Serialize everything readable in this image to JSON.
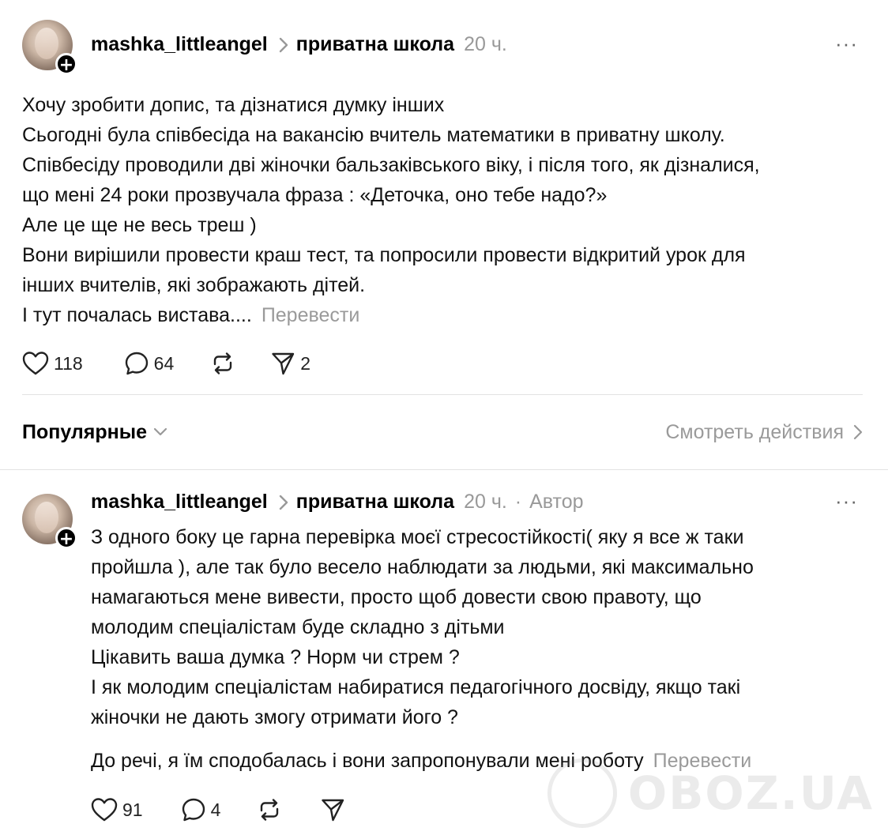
{
  "post": {
    "username": "mashka_littleangel",
    "community": "приватна школа",
    "time": "20 ч.",
    "more_icon": "···",
    "lines": [
      "Хочу зробити допис, та дізнатися думку інших",
      "Сьогодні була співбесіда на вакансію вчитель математики в приватну школу.",
      "Співбесіду проводили дві жіночки бальзаківського віку, і після того, як дізналися,",
      "що мені 24 роки прозвучала фраза : «Деточка, оно тебе надо?»",
      "Але це ще не весь треш )",
      "Вони вирішили провести краш тест, та попросили провести відкритий урок для",
      "інших вчителів, які зображають дітей.",
      "І тут почалась вистава...."
    ],
    "translate": "Перевести",
    "likes": "118",
    "comments": "64",
    "shares": "2"
  },
  "sort_bar": {
    "label": "Популярные",
    "see_actions": "Смотреть действия"
  },
  "reply": {
    "username": "mashka_littleangel",
    "community": "приватна школа",
    "time": "20 ч.",
    "dot": "·",
    "author": "Автор",
    "more_icon": "···",
    "lines": [
      "З одного боку це гарна перевірка моєї стресостійкості( яку я все ж таки",
      "пройшла ), але так було весело наблюдати за людьми, які максимально",
      "намагаються мене вивести, просто щоб довести свою правоту, що",
      "молодим спеціалістам буде складно з дітьми",
      "Цікавить ваша думка ? Норм чи стрем ?",
      "І як молодим спеціалістам набиратися педагогічного досвіду, якщо такі",
      "жіночки не дають змогу отримати його ?"
    ],
    "last_line": "До речі, я їм сподобалась і вони запропонували мені роботу",
    "translate": "Перевести",
    "likes": "91",
    "comments": "4"
  },
  "watermark": "OBOZ.UA",
  "icons": [
    "avatar",
    "follow-plus-icon",
    "chevron-right-icon",
    "more-icon",
    "heart-icon",
    "comment-icon",
    "repost-icon",
    "share-icon",
    "chevron-down-icon"
  ]
}
